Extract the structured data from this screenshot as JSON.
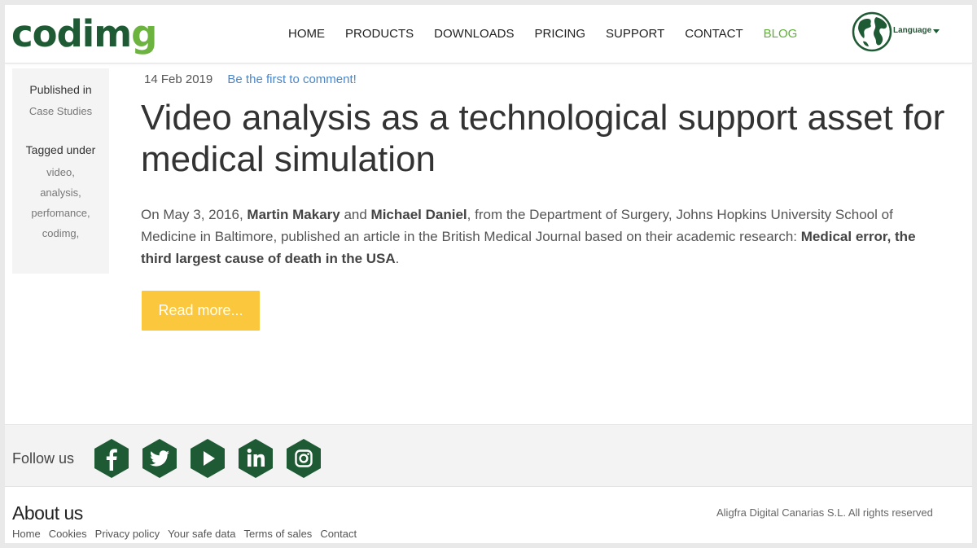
{
  "logo": {
    "main": "codim",
    "accent": "g"
  },
  "nav": {
    "items": [
      "HOME",
      "PRODUCTS",
      "DOWNLOADS",
      "PRICING",
      "SUPPORT",
      "CONTACT",
      "BLOG"
    ],
    "active": "BLOG"
  },
  "language": {
    "label": "Language",
    "icon": "globe-icon"
  },
  "meta": {
    "published_label": "Published in",
    "published_value": "Case Studies",
    "tagged_label": "Tagged under",
    "tags": [
      "video,",
      "analysis,",
      "perfomance,",
      "codimg,"
    ]
  },
  "post": {
    "date": "14 Feb 2019",
    "comment_link": "Be the first to comment!",
    "title": "Video analysis as a technological support asset for medical simulation",
    "excerpt": {
      "p1": "On May 3, 2016, ",
      "b1": "Martin Makary",
      "p2": " and ",
      "b2": "Michael Daniel",
      "p3": ", from the Department of Surgery, Johns Hopkins University School of Medicine in Baltimore, published an article in the British Medical Journal based on their academic research: ",
      "b3": "Medical error, the third largest cause of death in the USA",
      "p4": "."
    },
    "read_more": "Read more..."
  },
  "follow": {
    "label": "Follow us",
    "networks": [
      "facebook-icon",
      "twitter-icon",
      "youtube-icon",
      "linkedin-icon",
      "instagram-icon"
    ]
  },
  "footer": {
    "about": "About us",
    "links": [
      "Home",
      "Cookies",
      "Privacy policy",
      "Your safe data",
      "Terms of sales",
      "Contact"
    ],
    "copyright": "Aligfra Digital Canarias S.L. All rights reserved"
  },
  "colors": {
    "brand": "#1e5a33",
    "accent": "#6cb33f",
    "button": "#fbc73c",
    "link": "#4a86c8"
  }
}
